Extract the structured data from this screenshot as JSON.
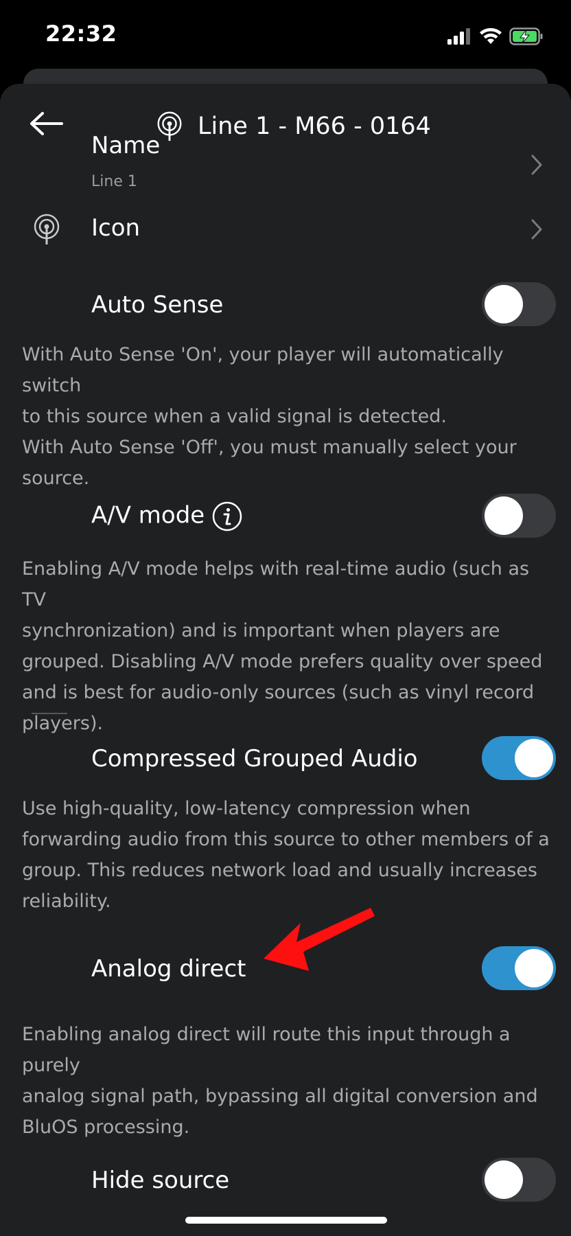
{
  "status_bar": {
    "time": "22:32",
    "signal_icon": "cellular-signal-icon",
    "wifi_icon": "wifi-icon",
    "battery_icon": "battery-charging-icon"
  },
  "header": {
    "title": "Line 1 - M66 - 0164",
    "back_icon": "back-arrow-icon",
    "source_icon": "antenna-icon"
  },
  "rows": {
    "name": {
      "title": "Name",
      "value": "Line 1"
    },
    "icon": {
      "title": "Icon"
    },
    "auto_sense": {
      "title": "Auto Sense",
      "enabled": false,
      "desc_lines": [
        "With Auto Sense 'On', your player will automatically switch",
        "to this source when a valid signal is detected.",
        "With Auto Sense 'Off', you must manually select your",
        "source."
      ]
    },
    "av_mode": {
      "title": "A/V mode",
      "enabled": false,
      "desc_lines": [
        "Enabling A/V mode helps with real-time audio (such as TV",
        "synchronization) and is important when players are",
        "grouped. Disabling A/V mode prefers quality over speed",
        "and is best for audio-only sources (such as vinyl record",
        "players)."
      ]
    },
    "compressed_grouped_audio": {
      "title": "Compressed Grouped Audio",
      "enabled": true,
      "desc_lines": [
        "Use high-quality, low-latency compression when",
        "forwarding audio from this source to other members of a",
        "group. This reduces network load and usually increases",
        "reliability."
      ]
    },
    "analog_direct": {
      "title": "Analog direct",
      "enabled": true,
      "desc_lines": [
        "Enabling analog direct will route this input through a purely",
        "analog signal path, bypassing all digital conversion and",
        "BluOS processing."
      ]
    },
    "hide_source": {
      "title": "Hide source",
      "enabled": false
    }
  },
  "colors": {
    "sheet_bg": "#1f2022",
    "toggle_on": "#2e92cf",
    "toggle_off": "#3a3b3f",
    "annotation_arrow": "#ff0000"
  }
}
